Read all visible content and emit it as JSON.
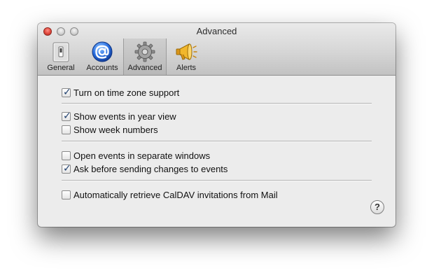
{
  "window": {
    "title": "Advanced"
  },
  "toolbar": {
    "tabs": [
      {
        "label": "General",
        "icon": "switch-icon"
      },
      {
        "label": "Accounts",
        "icon": "at-sign-icon"
      },
      {
        "label": "Advanced",
        "icon": "gear-icon",
        "selected": true
      },
      {
        "label": "Alerts",
        "icon": "megaphone-icon"
      }
    ]
  },
  "options": [
    {
      "label": "Turn on time zone support",
      "checked": true
    },
    {
      "label": "Show events in year view",
      "checked": true
    },
    {
      "label": "Show week numbers",
      "checked": false
    },
    {
      "label": "Open events in separate windows",
      "checked": false
    },
    {
      "label": "Ask before sending changes to events",
      "checked": true
    },
    {
      "label": "Automatically retrieve CalDAV invitations from Mail",
      "checked": false
    }
  ],
  "help": {
    "label": "?"
  },
  "check_glyph": "✓",
  "colors": {
    "accent": "#1f3f6e",
    "close_button": "#e0473c"
  }
}
